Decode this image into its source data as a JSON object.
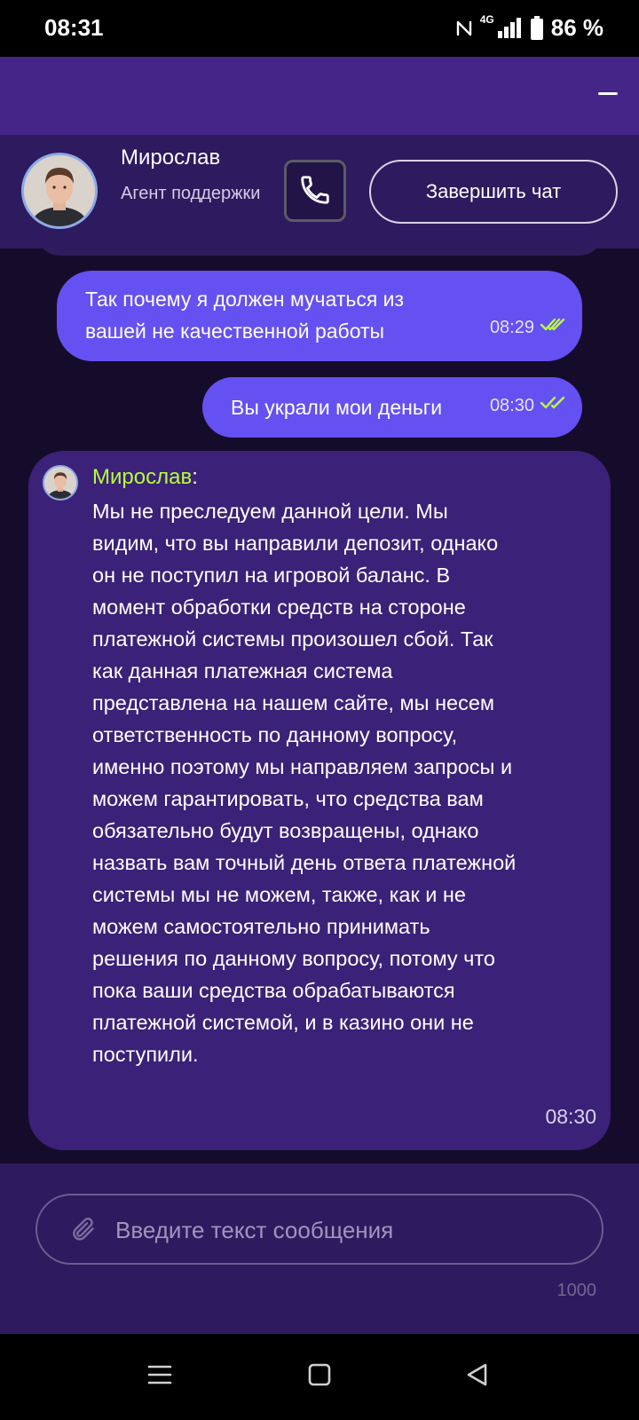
{
  "status_bar": {
    "time": "08:31",
    "network": "4G",
    "battery": "86 %"
  },
  "agent": {
    "name": "Мирослав",
    "role": "Агент поддержки",
    "end_chat_label": "Завершить чат"
  },
  "messages": [
    {
      "direction": "outgoing",
      "text": "Так почему я должен мучаться из вашей не качественной работы",
      "time": "08:29",
      "status": "read"
    },
    {
      "direction": "outgoing",
      "text": "Вы украли мои деньги",
      "time": "08:30",
      "status": "read"
    },
    {
      "direction": "incoming",
      "sender": "Мирослав",
      "text": "Мы не преследуем данной цели. Мы видим, что вы направили депозит, однако он не поступил на игровой баланс. В момент обработки средств на стороне платежной системы произошел сбой. Так как данная платежная система представлена на нашем сайте, мы несем ответственность по данному вопросу, именно поэтому мы направляем запросы и можем гарантировать, что средства вам обязательно будут возвращены, однако назвать вам точный день ответа платежной системы мы не можем, также, как и не можем самостоятельно принимать решения по данному вопросу, потому что пока ваши средства обрабатываются платежной системой, и в казино они не поступили.",
      "time": "08:30"
    }
  ],
  "composer": {
    "placeholder": "Введите текст сообщения",
    "value": "",
    "char_limit": "1000"
  },
  "icons": {
    "status": [
      "nfc-icon",
      "data-arrows-icon",
      "signal-icon",
      "battery-icon"
    ],
    "header": [
      "minimize-icon",
      "phone-icon"
    ],
    "message_status": "double-check-icon",
    "composer": "paperclip-icon",
    "nav": [
      "menu-icon",
      "home-icon",
      "back-icon"
    ]
  },
  "colors": {
    "outgoing_bubble": "#6550f2",
    "incoming_bubble": "#3b2178",
    "sender_name": "#b8ff3a",
    "read_check": "#b8ff3a",
    "header": "#452587",
    "agent_bar": "#2e1a5e"
  }
}
